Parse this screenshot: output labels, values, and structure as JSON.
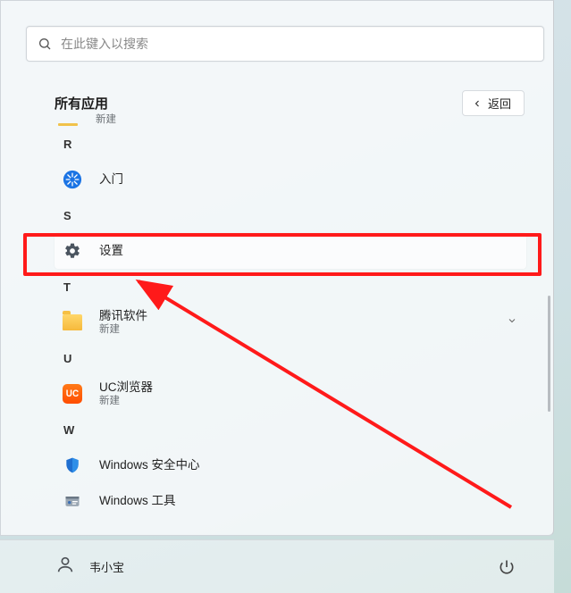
{
  "search": {
    "placeholder": "在此键入以搜索"
  },
  "header": {
    "title": "所有应用",
    "back_label": "返回"
  },
  "items": {
    "cut_sub": "新建",
    "letter_r": "R",
    "rumen": "入门",
    "letter_s": "S",
    "settings": "设置",
    "letter_t": "T",
    "tencent": "腾讯软件",
    "tencent_sub": "新建",
    "letter_u": "U",
    "uc": "UC浏览器",
    "uc_sub": "新建",
    "letter_w": "W",
    "win_sec": "Windows 安全中心",
    "win_tools": "Windows 工具"
  },
  "user": {
    "name": "韦小宝"
  }
}
